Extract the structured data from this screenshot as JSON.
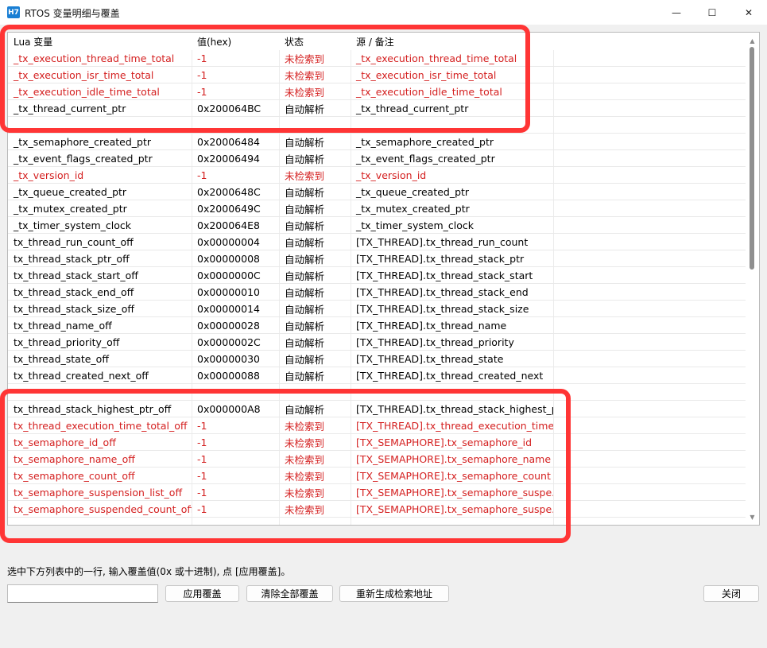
{
  "window": {
    "icon_text": "H7",
    "title": "RTOS 变量明细与覆盖",
    "minimize_glyph": "—",
    "maximize_glyph": "☐",
    "close_glyph": "✕"
  },
  "table": {
    "columns": [
      "Lua 变量",
      "值(hex)",
      "状态",
      "源 / 备注"
    ],
    "rows": [
      {
        "name": "_tx_execution_thread_time_total",
        "value": "-1",
        "status": "未检索到",
        "source": "_tx_execution_thread_time_total",
        "red": true
      },
      {
        "name": "_tx_execution_isr_time_total",
        "value": "-1",
        "status": "未检索到",
        "source": "_tx_execution_isr_time_total",
        "red": true
      },
      {
        "name": "_tx_execution_idle_time_total",
        "value": "-1",
        "status": "未检索到",
        "source": "_tx_execution_idle_time_total",
        "red": true
      },
      {
        "name": "_tx_thread_current_ptr",
        "value": "0x200064BC",
        "status": "自动解析",
        "source": "_tx_thread_current_ptr",
        "red": false
      },
      {
        "name": "",
        "value": "",
        "status": "",
        "source": "",
        "red": false
      },
      {
        "name": "_tx_semaphore_created_ptr",
        "value": "0x20006484",
        "status": "自动解析",
        "source": "_tx_semaphore_created_ptr",
        "red": false
      },
      {
        "name": "_tx_event_flags_created_ptr",
        "value": "0x20006494",
        "status": "自动解析",
        "source": "_tx_event_flags_created_ptr",
        "red": false
      },
      {
        "name": "_tx_version_id",
        "value": "-1",
        "status": "未检索到",
        "source": "_tx_version_id",
        "red": true
      },
      {
        "name": "_tx_queue_created_ptr",
        "value": "0x2000648C",
        "status": "自动解析",
        "source": "_tx_queue_created_ptr",
        "red": false
      },
      {
        "name": "_tx_mutex_created_ptr",
        "value": "0x2000649C",
        "status": "自动解析",
        "source": "_tx_mutex_created_ptr",
        "red": false
      },
      {
        "name": "_tx_timer_system_clock",
        "value": "0x200064E8",
        "status": "自动解析",
        "source": "_tx_timer_system_clock",
        "red": false
      },
      {
        "name": "tx_thread_run_count_off",
        "value": "0x00000004",
        "status": "自动解析",
        "source": "[TX_THREAD].tx_thread_run_count",
        "red": false
      },
      {
        "name": "tx_thread_stack_ptr_off",
        "value": "0x00000008",
        "status": "自动解析",
        "source": "[TX_THREAD].tx_thread_stack_ptr",
        "red": false
      },
      {
        "name": "tx_thread_stack_start_off",
        "value": "0x0000000C",
        "status": "自动解析",
        "source": "[TX_THREAD].tx_thread_stack_start",
        "red": false
      },
      {
        "name": "tx_thread_stack_end_off",
        "value": "0x00000010",
        "status": "自动解析",
        "source": "[TX_THREAD].tx_thread_stack_end",
        "red": false
      },
      {
        "name": "tx_thread_stack_size_off",
        "value": "0x00000014",
        "status": "自动解析",
        "source": "[TX_THREAD].tx_thread_stack_size",
        "red": false
      },
      {
        "name": "tx_thread_name_off",
        "value": "0x00000028",
        "status": "自动解析",
        "source": "[TX_THREAD].tx_thread_name",
        "red": false
      },
      {
        "name": "tx_thread_priority_off",
        "value": "0x0000002C",
        "status": "自动解析",
        "source": "[TX_THREAD].tx_thread_priority",
        "red": false
      },
      {
        "name": "tx_thread_state_off",
        "value": "0x00000030",
        "status": "自动解析",
        "source": "[TX_THREAD].tx_thread_state",
        "red": false
      },
      {
        "name": "tx_thread_created_next_off",
        "value": "0x00000088",
        "status": "自动解析",
        "source": "[TX_THREAD].tx_thread_created_next",
        "red": false
      },
      {
        "name": "",
        "value": "",
        "status": "",
        "source": "",
        "red": false
      },
      {
        "name": "tx_thread_stack_highest_ptr_off",
        "value": "0x000000A8",
        "status": "自动解析",
        "source": "[TX_THREAD].tx_thread_stack_highest_ptr",
        "red": false
      },
      {
        "name": "tx_thread_execution_time_total_off",
        "value": "-1",
        "status": "未检索到",
        "source": "[TX_THREAD].tx_thread_execution_time_t...",
        "red": true
      },
      {
        "name": "tx_semaphore_id_off",
        "value": "-1",
        "status": "未检索到",
        "source": "[TX_SEMAPHORE].tx_semaphore_id",
        "red": true
      },
      {
        "name": "tx_semaphore_name_off",
        "value": "-1",
        "status": "未检索到",
        "source": "[TX_SEMAPHORE].tx_semaphore_name",
        "red": true
      },
      {
        "name": "tx_semaphore_count_off",
        "value": "-1",
        "status": "未检索到",
        "source": "[TX_SEMAPHORE].tx_semaphore_count",
        "red": true
      },
      {
        "name": "tx_semaphore_suspension_list_off",
        "value": "-1",
        "status": "未检索到",
        "source": "[TX_SEMAPHORE].tx_semaphore_suspe...",
        "red": true
      },
      {
        "name": "tx_semaphore_suspended_count_off",
        "value": "-1",
        "status": "未检索到",
        "source": "[TX_SEMAPHORE].tx_semaphore_suspe...",
        "red": true
      }
    ]
  },
  "scrollbar": {
    "up_glyph": "▲",
    "down_glyph": "▼"
  },
  "footer": {
    "hint": "选中下方列表中的一行, 输入覆盖值(0x 或十进制), 点 [应用覆盖]。",
    "input_value": "",
    "apply_label": "应用覆盖",
    "clear_label": "清除全部覆盖",
    "regen_label": "重新生成检索地址",
    "close_label": "关闭"
  },
  "colors": {
    "error_red": "#d41f1f",
    "highlight_red": "#ff3535"
  }
}
